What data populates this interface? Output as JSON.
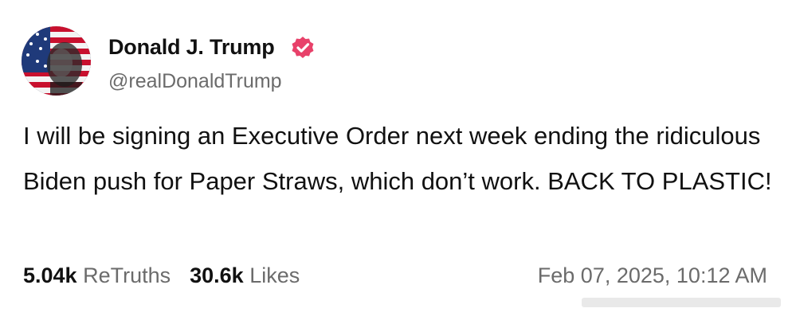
{
  "post": {
    "author": {
      "display_name": "Donald J. Trump",
      "handle": "@realDonaldTrump",
      "verified": true,
      "badge_color": "#e8416a",
      "avatar_icon": "avatar-portrait-flag"
    },
    "text": "I will be signing an Executive Order next week ending the ridiculous Biden push for Paper Straws, which don’t work. BACK TO PLASTIC!",
    "stats": {
      "retruths_count": "5.04k",
      "retruths_label": "ReTruths",
      "likes_count": "30.6k",
      "likes_label": "Likes"
    },
    "timestamp": "Feb 07, 2025, 10:12 AM"
  },
  "colors": {
    "text_primary": "#111111",
    "text_secondary": "#6b6b6b",
    "background": "#ffffff"
  }
}
